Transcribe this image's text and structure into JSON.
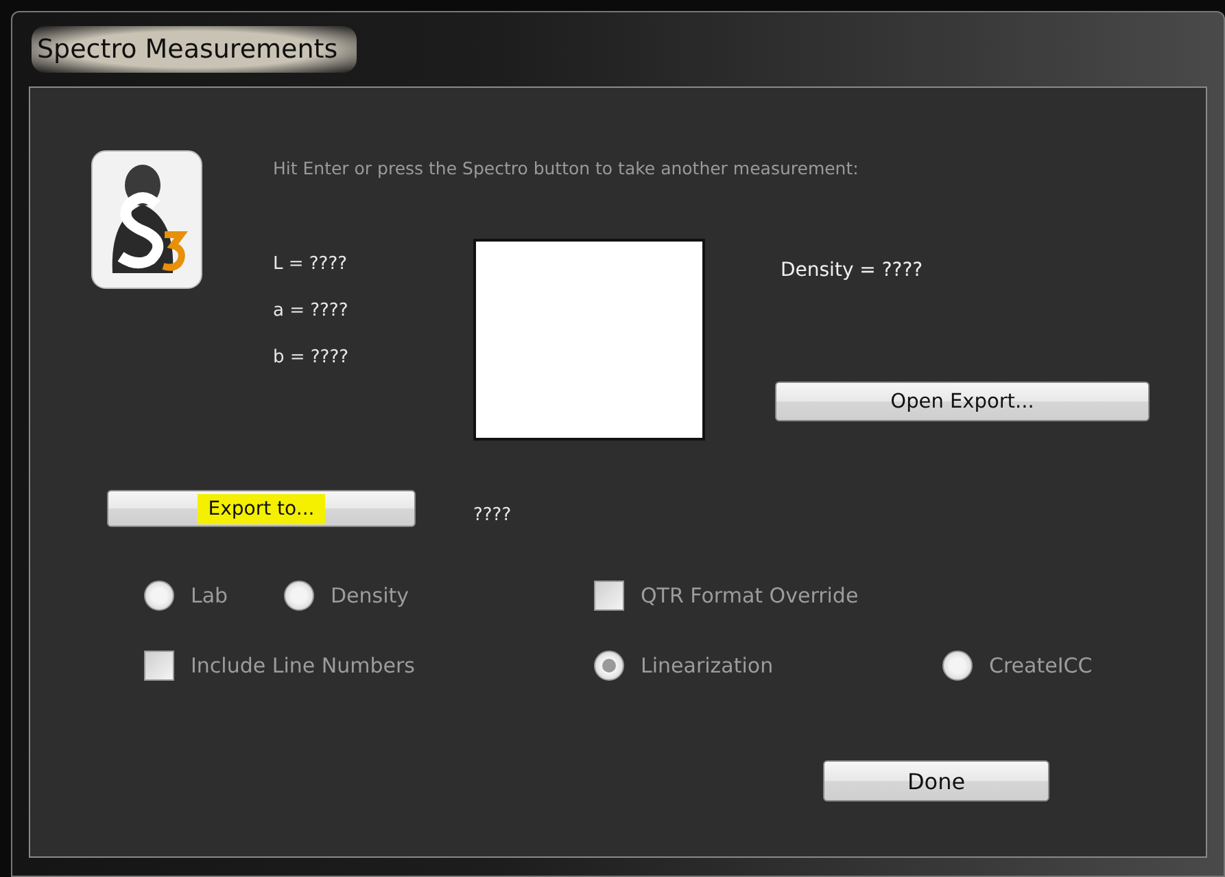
{
  "window": {
    "title": "Spectro Measurements"
  },
  "prompt": "Hit Enter or press the Spectro button to take another measurement:",
  "readings": [
    "L = ????",
    "a = ????",
    "b = ????"
  ],
  "density": "Density = ????",
  "open_export_button": "Open Export...",
  "export_button": {
    "label": "Export to...",
    "highlighted": true
  },
  "export_path": "????",
  "option_rows": [
    [
      {
        "kind": "radio",
        "label": "Lab",
        "selected": false,
        "disabled": true
      },
      {
        "kind": "radio",
        "label": "Density",
        "selected": false,
        "disabled": true
      },
      {
        "kind": "checkbox",
        "label": "QTR Format Override",
        "checked": false,
        "disabled": true
      }
    ],
    [
      {
        "kind": "checkbox",
        "label": "Include Line Numbers",
        "checked": false,
        "disabled": true
      },
      {
        "kind": "radio",
        "label": "Linearization",
        "selected": true,
        "disabled": true
      },
      {
        "kind": "radio",
        "label": "CreateICC",
        "selected": false,
        "disabled": true
      }
    ]
  ],
  "done_button": "Done"
}
